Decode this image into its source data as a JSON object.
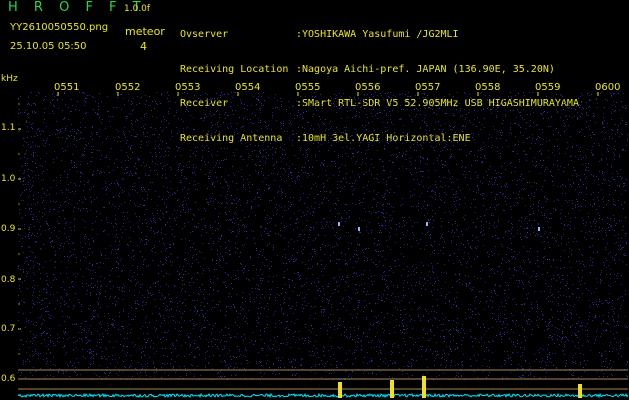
{
  "header": {
    "logo": "H R O F F T",
    "version": "1.0.0f",
    "filename": "YY2610050550.png",
    "datetime": "25.10.05 05:50",
    "meteor_label": "meteor",
    "meteor_count": "4"
  },
  "station": {
    "labels": [
      "Ovserver",
      "Receiving Location",
      "Receiver",
      "Receiving Antenna"
    ],
    "values": [
      ":YOSHIKAWA Yasufumi /JG2MLI",
      ":Nagoya Aichi-pref. JAPAN (136.90E, 35.20N)",
      ":SMart RTL-SDR V5 52.905MHz USB HIGASHIMURAYAMA",
      ":10mH 3el.YAGI Horizontal:ENE"
    ]
  },
  "axis": {
    "unit": "kHz",
    "freq_labels": [
      "1.1",
      "1.0",
      "0.9",
      "0.8",
      "0.7",
      "0.6"
    ],
    "time_labels": [
      "0551",
      "0552",
      "0553",
      "0554",
      "0555",
      "0556",
      "0557",
      "0558",
      "0559",
      "0600"
    ]
  },
  "colors": {
    "background": "#000000",
    "noise": "#2a2aa0",
    "signal": "#8fb6ff",
    "spectrum_trace": "#00e5ff",
    "spectrum_peak": "#f0e020",
    "guide_line": "#a08858"
  },
  "events": [
    {
      "time": "0556",
      "freq_khz": 0.91
    },
    {
      "time": "0557",
      "freq_khz": 0.91
    },
    {
      "time": "0556",
      "freq_khz": 0.9
    },
    {
      "time": "0559",
      "freq_khz": 0.9
    }
  ]
}
